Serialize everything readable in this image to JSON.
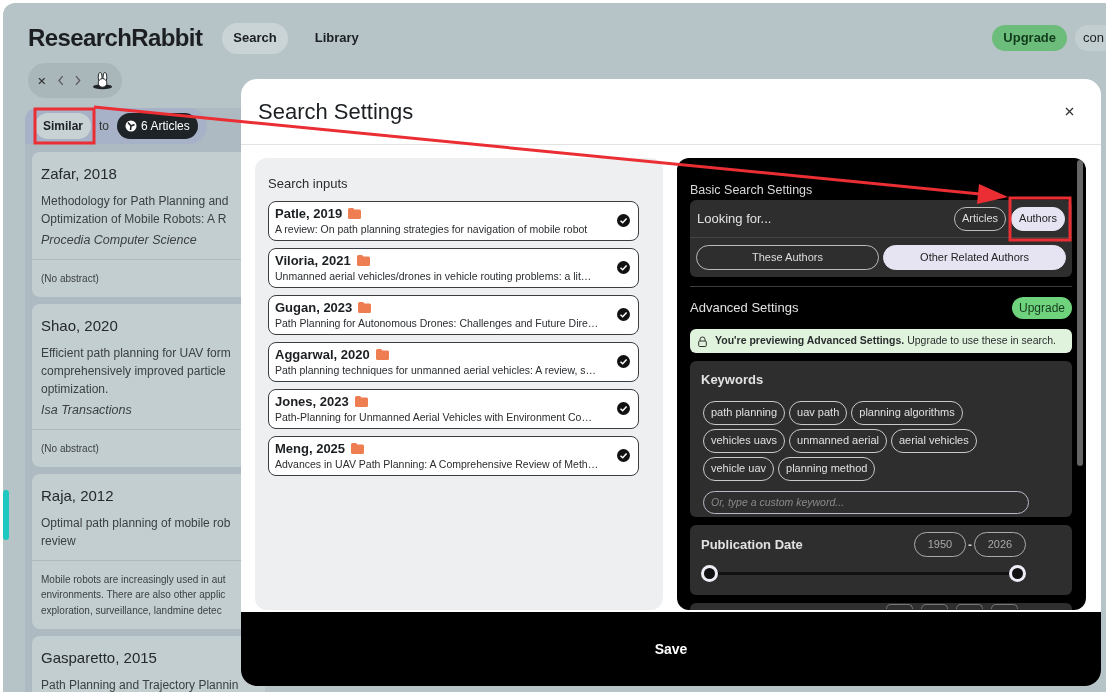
{
  "app": {
    "logo": "ResearchRabbit",
    "nav": [
      {
        "label": "Search",
        "selected": true
      },
      {
        "label": "Library",
        "selected": false
      }
    ],
    "upgrade": "Upgrade",
    "account": "con"
  },
  "column": {
    "mode": "Similar",
    "connector": "to",
    "source": "6 Articles",
    "cards": [
      {
        "title": "Zafar, 2018",
        "lines": [
          "Methodology for Path Planning and",
          "Optimization of Mobile Robots: A R"
        ],
        "journal": "Procedia Computer Science",
        "abstract_lines": [
          "(No abstract)"
        ]
      },
      {
        "title": "Shao, 2020",
        "lines": [
          "Efficient path planning for UAV form",
          "comprehensively improved particle",
          "optimization."
        ],
        "journal": "Isa Transactions",
        "abstract_lines": [
          "(No abstract)"
        ]
      },
      {
        "title": "Raja, 2012",
        "lines": [
          "Optimal path planning of mobile rob",
          "review"
        ],
        "abstract_lines": [
          "Mobile robots are increasingly used in aut",
          "environments. There are also other applic",
          "exploration, surveillance, landmine detec"
        ]
      },
      {
        "title": "Gasparetto, 2015",
        "lines": [
          "Path Planning and Trajectory Plannin"
        ]
      }
    ]
  },
  "dialog": {
    "title": "Search Settings",
    "inputs_heading": "Search inputs",
    "inputs": [
      {
        "title": "Patle, 2019",
        "summary": "A review: On path planning strategies for navigation of mobile robot",
        "checked": true
      },
      {
        "title": "Viloria, 2021",
        "summary": "Unmanned aerial vehicles/drones in vehicle routing problems: a lit…",
        "checked": true
      },
      {
        "title": "Gugan, 2023",
        "summary": "Path Planning for Autonomous Drones: Challenges and Future Dire…",
        "checked": true
      },
      {
        "title": "Aggarwal, 2020",
        "summary": "Path planning techniques for unmanned aerial vehicles: A review, s…",
        "checked": true
      },
      {
        "title": "Jones, 2023",
        "summary": "Path-Planning for Unmanned Aerial Vehicles with Environment Co…",
        "checked": true
      },
      {
        "title": "Meng, 2025",
        "summary": "Advances in UAV Path Planning: A Comprehensive Review of Meth…",
        "checked": true
      }
    ],
    "basic": {
      "heading": "Basic Search Settings",
      "looking_for": "Looking for...",
      "types": [
        {
          "label": "Articles",
          "selected": false
        },
        {
          "label": "Authors",
          "selected": true
        }
      ],
      "author_scopes": [
        {
          "label": "These Authors",
          "selected": false
        },
        {
          "label": "Other Related Authors",
          "selected": true
        }
      ]
    },
    "advanced": {
      "heading": "Advanced Settings",
      "upgrade": "Upgrade",
      "notice": "**You're previewing Advanced Settings.** Upgrade to use these in search.",
      "keywords": {
        "heading": "Keywords",
        "chips": [
          "path planning",
          "uav path",
          "planning algorithms",
          "vehicles uavs",
          "unmanned aerial",
          "aerial vehicles",
          "vehicle uav",
          "planning method"
        ],
        "placeholder": "Or, type a custom keyword..."
      },
      "publication_date": {
        "heading": "Publication Date",
        "from": "1950",
        "separator": "-",
        "to": "2026",
        "thumbs": [
          {
            "level": 0
          },
          {
            "level": 1
          }
        ]
      }
    },
    "save": "Save"
  }
}
